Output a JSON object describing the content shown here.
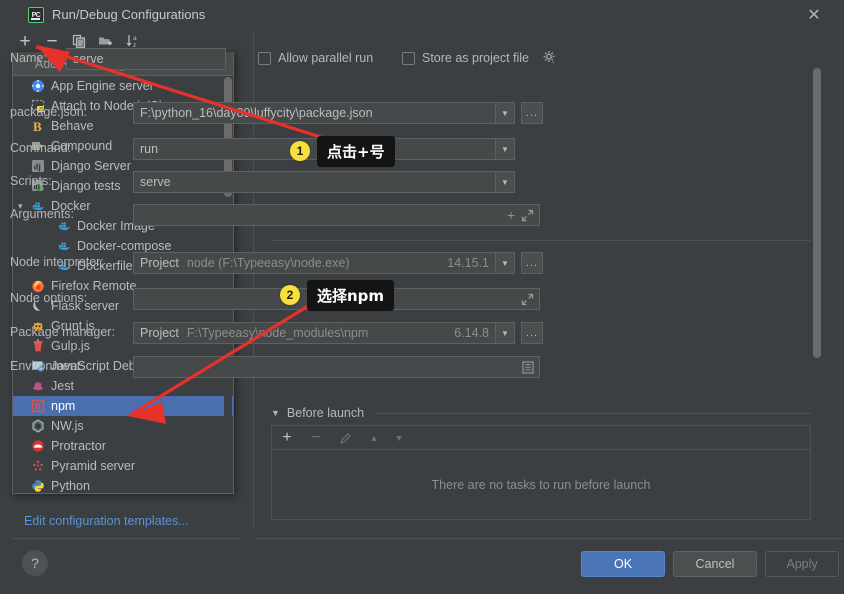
{
  "window": {
    "title": "Run/Debug Configurations",
    "app_icon": "pycharm-icon",
    "close_label": "✕"
  },
  "left_toolbar": {
    "items": [
      {
        "name": "add-configuration-button",
        "icon": "plus-icon",
        "glyph": "+"
      },
      {
        "name": "remove-configuration-button",
        "icon": "minus-icon",
        "glyph": "−"
      },
      {
        "name": "copy-configuration-button",
        "icon": "copy-icon",
        "glyph": ""
      },
      {
        "name": "new-folder-button",
        "icon": "folder-plus-icon",
        "glyph": ""
      },
      {
        "name": "sort-configurations-button",
        "icon": "sort-alpha-icon",
        "glyph": ""
      }
    ]
  },
  "popup": {
    "header": "Add New Configuration",
    "header_icon": "collapse-all-icon",
    "items": [
      {
        "label": "App Engine server",
        "icon": "app-engine-icon",
        "indent": 0,
        "expander": "",
        "selected": false
      },
      {
        "label": "Attach to Node.js/Chrome",
        "icon": "attach-node-icon",
        "indent": 0,
        "expander": "",
        "selected": false
      },
      {
        "label": "Behave",
        "icon": "behave-icon",
        "indent": 0,
        "expander": "",
        "selected": false
      },
      {
        "label": "Compound",
        "icon": "compound-icon",
        "indent": 0,
        "expander": "",
        "selected": false
      },
      {
        "label": "Django Server",
        "icon": "django-icon",
        "indent": 0,
        "expander": "",
        "selected": false
      },
      {
        "label": "Django tests",
        "icon": "django-tests-icon",
        "indent": 0,
        "expander": "",
        "selected": false
      },
      {
        "label": "Docker",
        "icon": "docker-icon",
        "indent": 0,
        "expander": "chevron-down-icon",
        "selected": false
      },
      {
        "label": "Docker Image",
        "icon": "docker-icon",
        "indent": 1,
        "expander": "",
        "selected": false
      },
      {
        "label": "Docker-compose",
        "icon": "docker-icon",
        "indent": 1,
        "expander": "",
        "selected": false
      },
      {
        "label": "Dockerfile",
        "icon": "docker-icon",
        "indent": 1,
        "expander": "",
        "selected": false
      },
      {
        "label": "Firefox Remote",
        "icon": "firefox-icon",
        "indent": 0,
        "expander": "",
        "selected": false
      },
      {
        "label": "Flask server",
        "icon": "flask-icon",
        "indent": 0,
        "expander": "",
        "selected": false
      },
      {
        "label": "Grunt.js",
        "icon": "grunt-icon",
        "indent": 0,
        "expander": "",
        "selected": false
      },
      {
        "label": "Gulp.js",
        "icon": "gulp-icon",
        "indent": 0,
        "expander": "",
        "selected": false
      },
      {
        "label": "JavaScript Debug",
        "icon": "javascript-debug-icon",
        "indent": 0,
        "expander": "",
        "selected": false
      },
      {
        "label": "Jest",
        "icon": "jest-icon",
        "indent": 0,
        "expander": "",
        "selected": false
      },
      {
        "label": "npm",
        "icon": "npm-icon",
        "indent": 0,
        "expander": "",
        "selected": true
      },
      {
        "label": "NW.js",
        "icon": "nwjs-icon",
        "indent": 0,
        "expander": "",
        "selected": false
      },
      {
        "label": "Protractor",
        "icon": "protractor-icon",
        "indent": 0,
        "expander": "",
        "selected": false
      },
      {
        "label": "Pyramid server",
        "icon": "pyramid-icon",
        "indent": 0,
        "expander": "",
        "selected": false
      },
      {
        "label": "Python",
        "icon": "python-icon",
        "indent": 0,
        "expander": "",
        "selected": false
      }
    ]
  },
  "left_footer": {
    "edit_templates_link": "Edit configuration templates...",
    "help_label": "?"
  },
  "form": {
    "name": {
      "label": "Name:",
      "value": "serve"
    },
    "allow_parallel_run": {
      "label": "Allow parallel run",
      "checked": false
    },
    "store_as_project_file": {
      "label": "Store as project file",
      "checked": false,
      "gear_icon": "gear-icon"
    },
    "package_json": {
      "label": "package.json:",
      "value": "F:\\python_16\\day89\\luffycity\\package.json",
      "browse": "..."
    },
    "command": {
      "label": "Command:",
      "value": "run"
    },
    "scripts": {
      "label": "Scripts:",
      "value": "serve"
    },
    "arguments": {
      "label": "Arguments:",
      "value": "",
      "add_icon": "plus-icon",
      "expand_icon": "expand-icon"
    },
    "node_interpreter": {
      "label": "Node interpreter:",
      "prefix": "Project",
      "value": "node (F:\\Typeeasy\\node.exe)",
      "version": "14.15.1",
      "browse": "..."
    },
    "node_options": {
      "label": "Node options:",
      "value": "",
      "expand_icon": "expand-icon"
    },
    "package_manager": {
      "label": "Package manager:",
      "prefix": "Project",
      "value": "F:\\Typeeasy\\node_modules\\npm",
      "version": "6.14.8",
      "browse": "..."
    },
    "environment": {
      "label": "Environment:",
      "value": "",
      "edit_icon": "environment-edit-icon"
    }
  },
  "before_launch": {
    "title": "Before launch",
    "empty_text": "There are no tasks to run before launch",
    "toolbar": [
      {
        "name": "add-task-button",
        "glyph": "+"
      },
      {
        "name": "remove-task-button",
        "glyph": "−"
      },
      {
        "name": "edit-task-button",
        "glyph": "✎"
      },
      {
        "name": "move-task-up-button",
        "glyph": "▲"
      },
      {
        "name": "move-task-down-button",
        "glyph": "▼"
      }
    ]
  },
  "footer": {
    "ok": "OK",
    "cancel": "Cancel",
    "apply": "Apply"
  },
  "annotations": [
    {
      "badge": "1",
      "text": "点击+号"
    },
    {
      "badge": "2",
      "text": "选择npm"
    }
  ],
  "colors": {
    "accent": "#4b6eaf",
    "annotation": "#e8312a",
    "badge": "#f7e03a",
    "link": "#5b93d8"
  }
}
